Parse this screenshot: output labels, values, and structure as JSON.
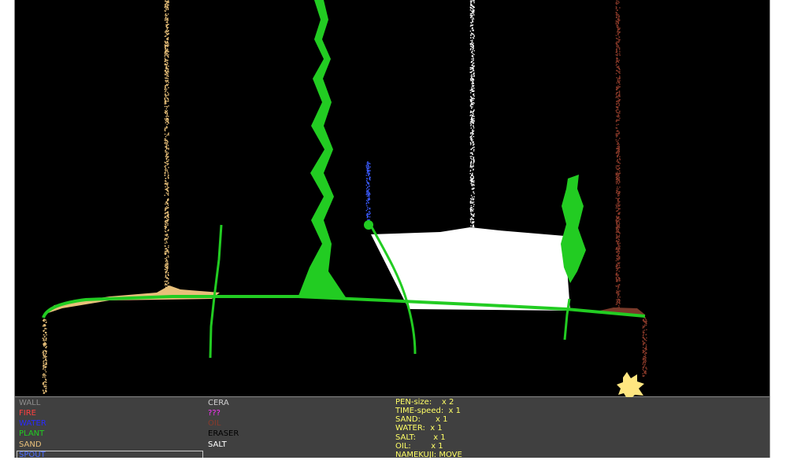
{
  "colors": {
    "background": "#000000",
    "panel": "#404040",
    "wall": "#8c8c8c",
    "fire": "#ff4040",
    "water": "#2a2aff",
    "plant": "#22cc22",
    "sand": "#e8c07a",
    "spout": "#4a6cff",
    "cera": "#d0d0d0",
    "unknown": "#ff33ff",
    "oil": "#8a3a2a",
    "eraser": "#ffffff",
    "salt": "#ffffff",
    "status": "#ffff66",
    "salt_pile": "#ffffff",
    "oil_pile": "#7a3a2a"
  },
  "elements": {
    "col1": [
      {
        "label": "WALL",
        "color": "#8c8c8c"
      },
      {
        "label": "FIRE",
        "color": "#ff4040"
      },
      {
        "label": "WATER",
        "color": "#2a2aff"
      },
      {
        "label": "PLANT",
        "color": "#22cc22"
      },
      {
        "label": "SAND",
        "color": "#e8c07a"
      },
      {
        "label": "SPOUT",
        "color": "#4a6cff"
      }
    ],
    "col2": [
      {
        "label": "CERA",
        "color": "#d0d0d0"
      },
      {
        "label": "???",
        "color": "#ff33ff"
      },
      {
        "label": "OIL",
        "color": "#8a3a2a"
      },
      {
        "label": "ERASER",
        "color": "#000000"
      },
      {
        "label": "SALT",
        "color": "#ffffff"
      }
    ]
  },
  "status": {
    "pen_size": "PEN-size:    x 2",
    "time_speed": "TIME-speed:  x 1",
    "sand": "SAND:      x 1",
    "water": "WATER:  x 1",
    "salt": "SALT:       x 1",
    "oil": "OIL:        x 1",
    "namekuji": "NAMEKUJI: MOVE"
  }
}
